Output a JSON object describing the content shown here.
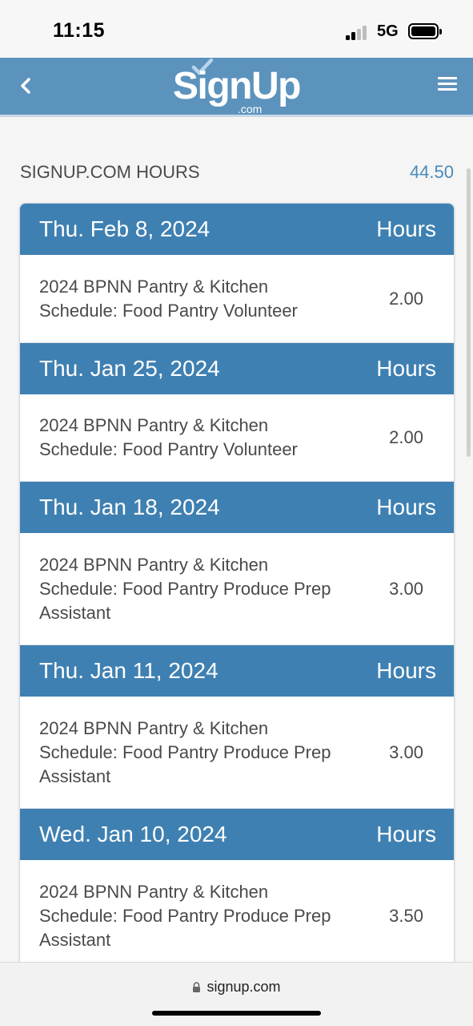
{
  "status_bar": {
    "time": "11:15",
    "network": "5G"
  },
  "header": {
    "logo_text": "SignUp",
    "logo_domain": ".com"
  },
  "summary": {
    "label": "SIGNUP.COM HOURS",
    "total": "44.50"
  },
  "entries": [
    {
      "date": "Thu. Feb 8, 2024",
      "hours_header": "Hours",
      "name": "2024 BPNN Pantry & Kitchen Schedule: Food Pantry Volunteer",
      "hours": "2.00"
    },
    {
      "date": "Thu. Jan 25, 2024",
      "hours_header": "Hours",
      "name": "2024 BPNN Pantry & Kitchen Schedule: Food Pantry Volunteer",
      "hours": "2.00"
    },
    {
      "date": "Thu. Jan 18, 2024",
      "hours_header": "Hours",
      "name": "2024 BPNN Pantry & Kitchen Schedule: Food Pantry Produce Prep Assistant",
      "hours": "3.00"
    },
    {
      "date": "Thu. Jan 11, 2024",
      "hours_header": "Hours",
      "name": "2024 BPNN Pantry & Kitchen Schedule: Food Pantry Produce Prep Assistant",
      "hours": "3.00"
    },
    {
      "date": "Wed. Jan 10, 2024",
      "hours_header": "Hours",
      "name": "2024 BPNN Pantry & Kitchen Schedule: Food Pantry Produce Prep Assistant",
      "hours": "3.50"
    }
  ],
  "browser": {
    "url": "signup.com"
  },
  "colors": {
    "header_bg": "#5c93bd",
    "day_header_bg": "#3f80b2",
    "accent_text": "#4a8ab8"
  }
}
